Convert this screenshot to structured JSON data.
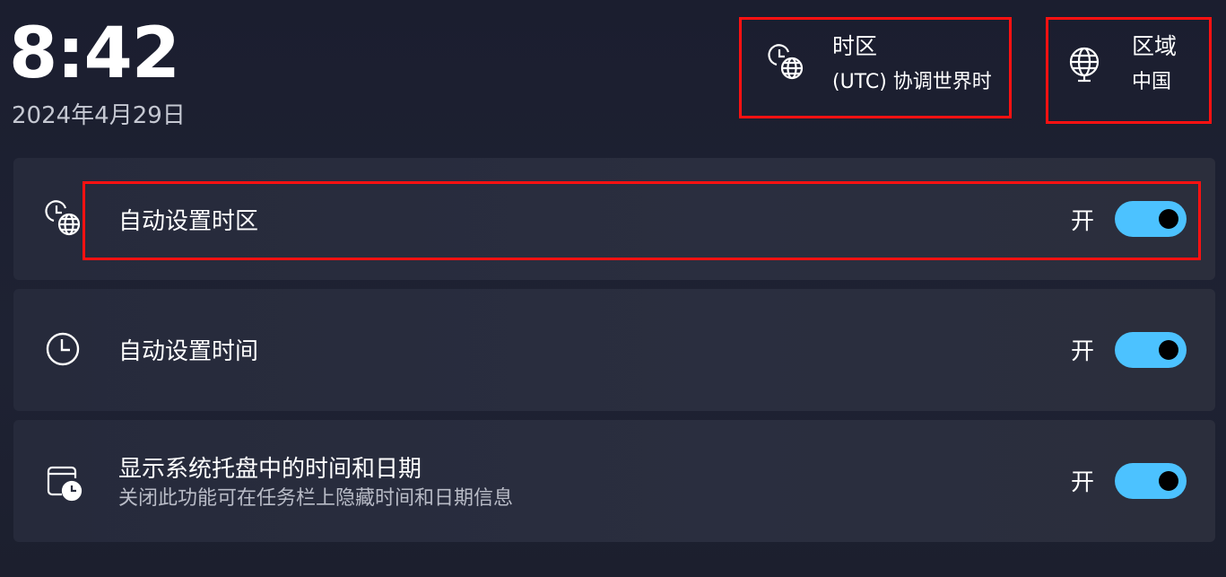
{
  "clock": {
    "time": "8:42",
    "date": "2024年4月29日"
  },
  "timezone": {
    "title": "时区",
    "value": "(UTC) 协调世界时",
    "icon": "clock-globe-icon"
  },
  "region": {
    "title": "区域",
    "value": "中国",
    "icon": "globe-icon"
  },
  "settings": [
    {
      "title": "自动设置时区",
      "state": "开",
      "icon": "clock-globe-icon",
      "on": true
    },
    {
      "title": "自动设置时间",
      "state": "开",
      "icon": "clock-icon",
      "on": true
    },
    {
      "title": "显示系统托盘中的时间和日期",
      "description": "关闭此功能可在任务栏上隐藏时间和日期信息",
      "state": "开",
      "icon": "calendar-clock-icon",
      "on": true
    }
  ],
  "colors": {
    "accent": "#4cc2ff",
    "highlight": "#ff1111",
    "background": "#1d2030",
    "card": "#282c3d"
  }
}
